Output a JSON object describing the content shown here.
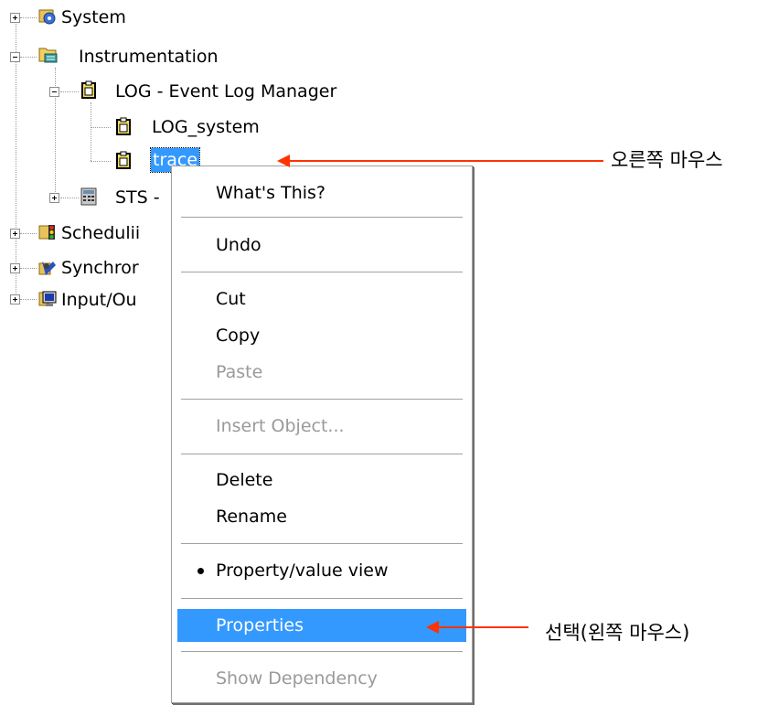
{
  "tree": {
    "items": [
      {
        "label": "System",
        "icon": "computer-icon"
      },
      {
        "label": "Instrumentation",
        "icon": "folder-instrument-icon"
      },
      {
        "label": "LOG - Event Log Manager",
        "icon": "clipboard-icon"
      },
      {
        "label": "LOG_system",
        "icon": "clipboard-icon"
      },
      {
        "label": "trace",
        "icon": "clipboard-icon"
      },
      {
        "label": "STS -",
        "icon": "calculator-icon"
      },
      {
        "label": "Schedulii",
        "icon": "scheduling-icon"
      },
      {
        "label": "Synchror",
        "icon": "synchronization-icon"
      },
      {
        "label": "Input/Ou",
        "icon": "monitor-icon"
      }
    ]
  },
  "context_menu": {
    "items": [
      {
        "label": "What's This?",
        "disabled": false
      },
      {
        "label": "Undo",
        "disabled": false
      },
      {
        "label": "Cut",
        "disabled": false
      },
      {
        "label": "Copy",
        "disabled": false
      },
      {
        "label": "Paste",
        "disabled": true
      },
      {
        "label": "Insert Object...",
        "disabled": true
      },
      {
        "label": "Delete",
        "disabled": false
      },
      {
        "label": "Rename",
        "disabled": false
      },
      {
        "label": "Property/value view",
        "disabled": false,
        "checked": true
      },
      {
        "label": "Properties",
        "disabled": false,
        "highlighted": true
      },
      {
        "label": "Show Dependency",
        "disabled": true
      }
    ]
  },
  "annotations": {
    "right_click_note": "오른쪽 마우스",
    "select_note": "선택(왼쪽 마우스)"
  },
  "colors": {
    "selection": "#3399ff",
    "arrow": "#ff3300"
  }
}
